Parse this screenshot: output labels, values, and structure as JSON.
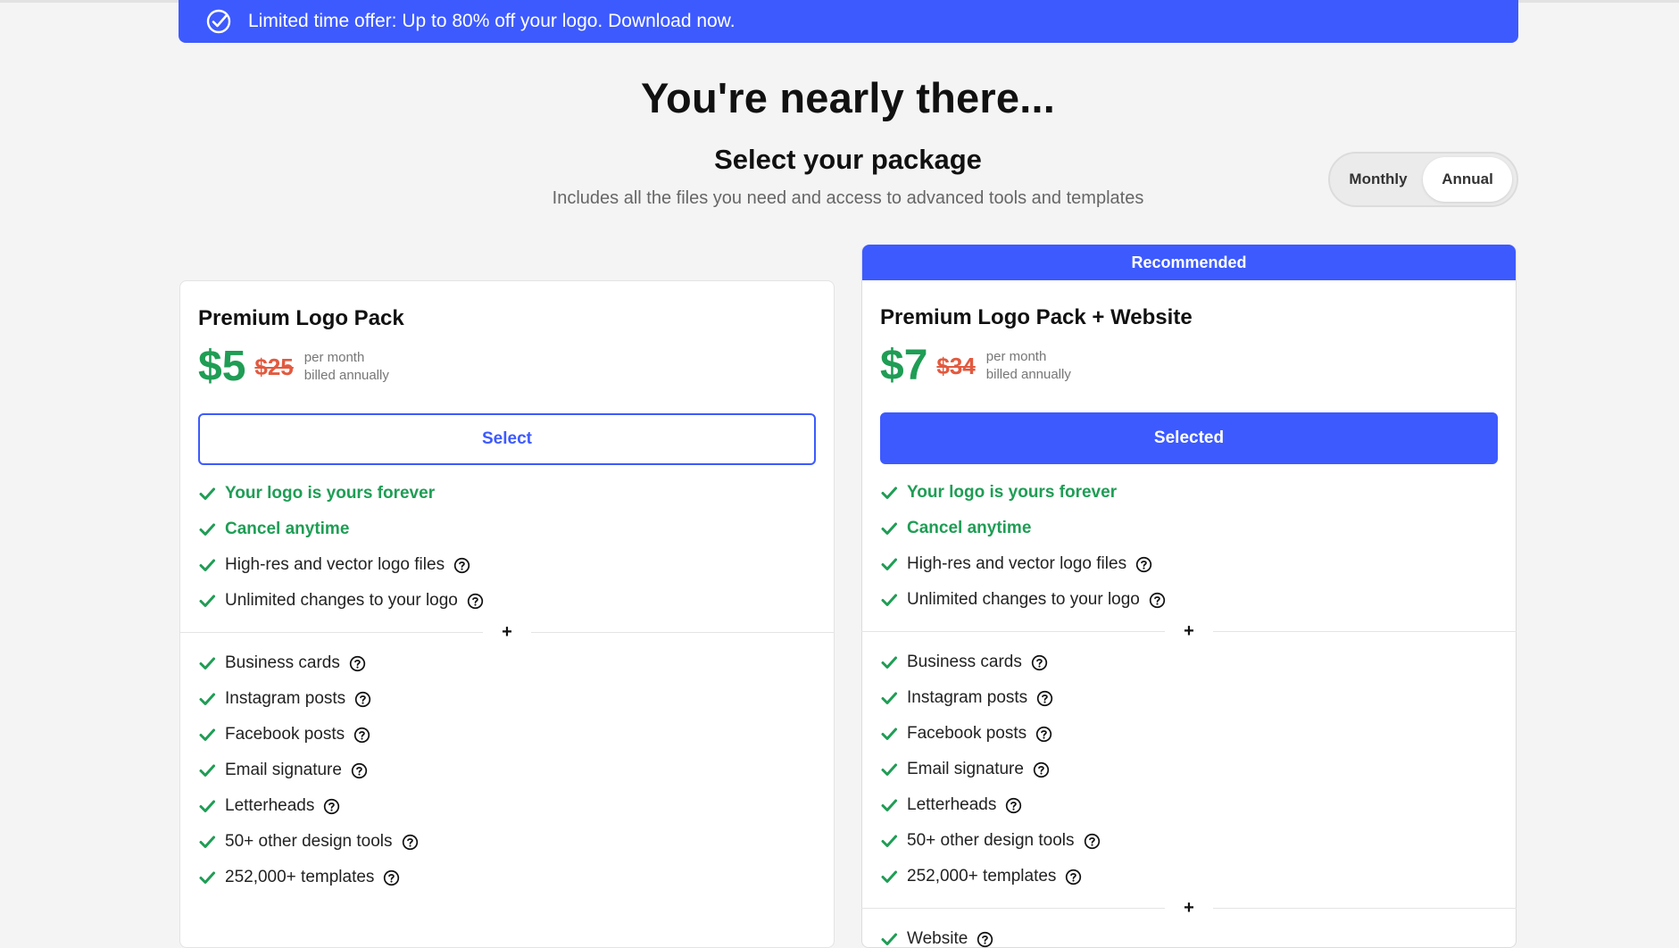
{
  "banner": {
    "icon": "check-circle-icon",
    "text": "Limited time offer: Up to 80% off your logo. Download now.",
    "color": "#3d5afe"
  },
  "header": {
    "title": "You're nearly there...",
    "subtitle": "Select your package",
    "description": "Includes all the files you need and access to advanced tools and templates"
  },
  "billing_toggle": {
    "options": [
      "Monthly",
      "Annual"
    ],
    "selected": "Annual"
  },
  "plans": [
    {
      "badge": "",
      "name": "Premium Logo Pack",
      "price": "$5",
      "old_price": "$25",
      "billing_line1": "per month",
      "billing_line2": "billed annually",
      "button_label": "Select",
      "selected": false,
      "core_features": [
        {
          "label": "Your logo is yours forever",
          "highlight": true,
          "help": false
        },
        {
          "label": "Cancel anytime",
          "highlight": true,
          "help": false
        },
        {
          "label": "High-res and vector logo files",
          "highlight": false,
          "help": true
        },
        {
          "label": "Unlimited changes to your logo",
          "highlight": false,
          "help": true
        }
      ],
      "plus_symbol": "+",
      "extra_features": [
        {
          "label": "Business cards",
          "help": true
        },
        {
          "label": "Instagram posts",
          "help": true
        },
        {
          "label": "Facebook posts",
          "help": true
        },
        {
          "label": "Email signature",
          "help": true
        },
        {
          "label": "Letterheads",
          "help": true
        },
        {
          "label": "50+ other design tools",
          "help": true
        },
        {
          "label": "252,000+ templates",
          "help": true
        }
      ]
    },
    {
      "badge": "Recommended",
      "name": "Premium Logo Pack + Website",
      "price": "$7",
      "old_price": "$34",
      "billing_line1": "per month",
      "billing_line2": "billed annually",
      "button_label": "Selected",
      "selected": true,
      "core_features": [
        {
          "label": "Your logo is yours forever",
          "highlight": true,
          "help": false
        },
        {
          "label": "Cancel anytime",
          "highlight": true,
          "help": false
        },
        {
          "label": "High-res and vector logo files",
          "highlight": false,
          "help": true
        },
        {
          "label": "Unlimited changes to your logo",
          "highlight": false,
          "help": true
        }
      ],
      "plus_symbol": "+",
      "extra_features": [
        {
          "label": "Business cards",
          "help": true
        },
        {
          "label": "Instagram posts",
          "help": true
        },
        {
          "label": "Facebook posts",
          "help": true
        },
        {
          "label": "Email signature",
          "help": true
        },
        {
          "label": "Letterheads",
          "help": true
        },
        {
          "label": "50+ other design tools",
          "help": true
        },
        {
          "label": "252,000+ templates",
          "help": true
        }
      ],
      "website_features": [
        {
          "label": "Website",
          "help": true
        }
      ]
    }
  ],
  "colors": {
    "accent": "#3d5afe",
    "green": "#1f9d55",
    "strike": "#e25a3f"
  }
}
